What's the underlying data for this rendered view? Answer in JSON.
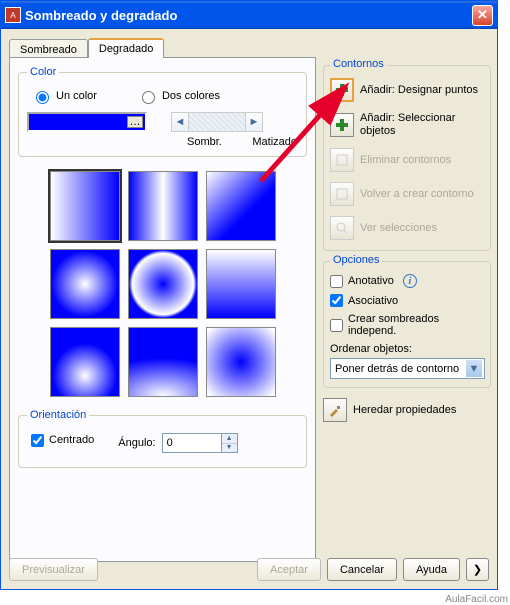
{
  "window": {
    "title": "Sombreado y degradado"
  },
  "tabs": {
    "shading": "Sombreado",
    "gradient": "Degradado"
  },
  "color": {
    "legend": "Color",
    "one": "Un color",
    "two": "Dos colores",
    "shade": "Sombr.",
    "tint": "Matizado"
  },
  "orientation": {
    "legend": "Orientación",
    "centered": "Centrado",
    "angle": "Ángulo:",
    "angle_value": "0"
  },
  "contours": {
    "legend": "Contornos",
    "add_points": "Añadir: Designar puntos",
    "add_select": "Añadir: Seleccionar objetos",
    "remove": "Eliminar contornos",
    "recreate": "Volver a crear contorno",
    "view_sel": "Ver selecciones"
  },
  "options": {
    "legend": "Opciones",
    "annotative": "Anotativo",
    "associative": "Asociativo",
    "independent": "Crear sombreados independ.",
    "order_label": "Ordenar objetos:",
    "order_value": "Poner detrás de contorno"
  },
  "inherit": "Heredar propiedades",
  "buttons": {
    "preview": "Previsualizar",
    "ok": "Aceptar",
    "cancel": "Cancelar",
    "help": "Ayuda"
  },
  "watermark": "AulaFacil.com"
}
